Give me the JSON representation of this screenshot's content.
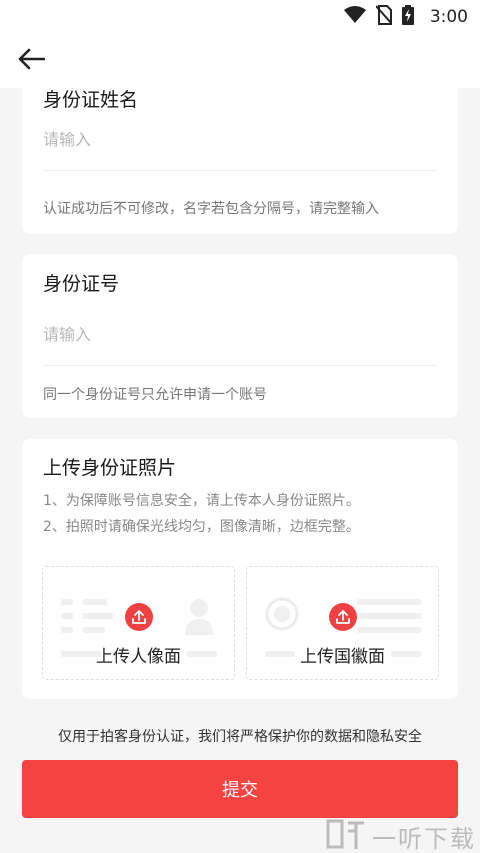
{
  "status_bar": {
    "time": "3:00"
  },
  "header": {
    "back_icon": "arrow-left-icon"
  },
  "name_card": {
    "title": "身份证姓名",
    "placeholder": "请输入",
    "hint": "认证成功后不可修改，名字若包含分隔号，请完整输入"
  },
  "id_card": {
    "title": "身份证号",
    "placeholder": "请输入",
    "hint": "同一个身份证号只允许申请一个账号"
  },
  "photo_card": {
    "title": "上传身份证照片",
    "notes": [
      "1、为保障账号信息安全，请上传本人身份证照片。",
      "2、拍照时请确保光线均匀，图像清晰，边框完整。"
    ],
    "front_label": "上传人像面",
    "back_label": "上传国徽面"
  },
  "privacy_text": "仅用于拍客身份认证，我们将严格保护你的数据和隐私安全",
  "submit_label": "提交",
  "watermark": {
    "text": "一听下载"
  },
  "colors": {
    "accent": "#f74242",
    "upload_icon": "#f04142"
  }
}
